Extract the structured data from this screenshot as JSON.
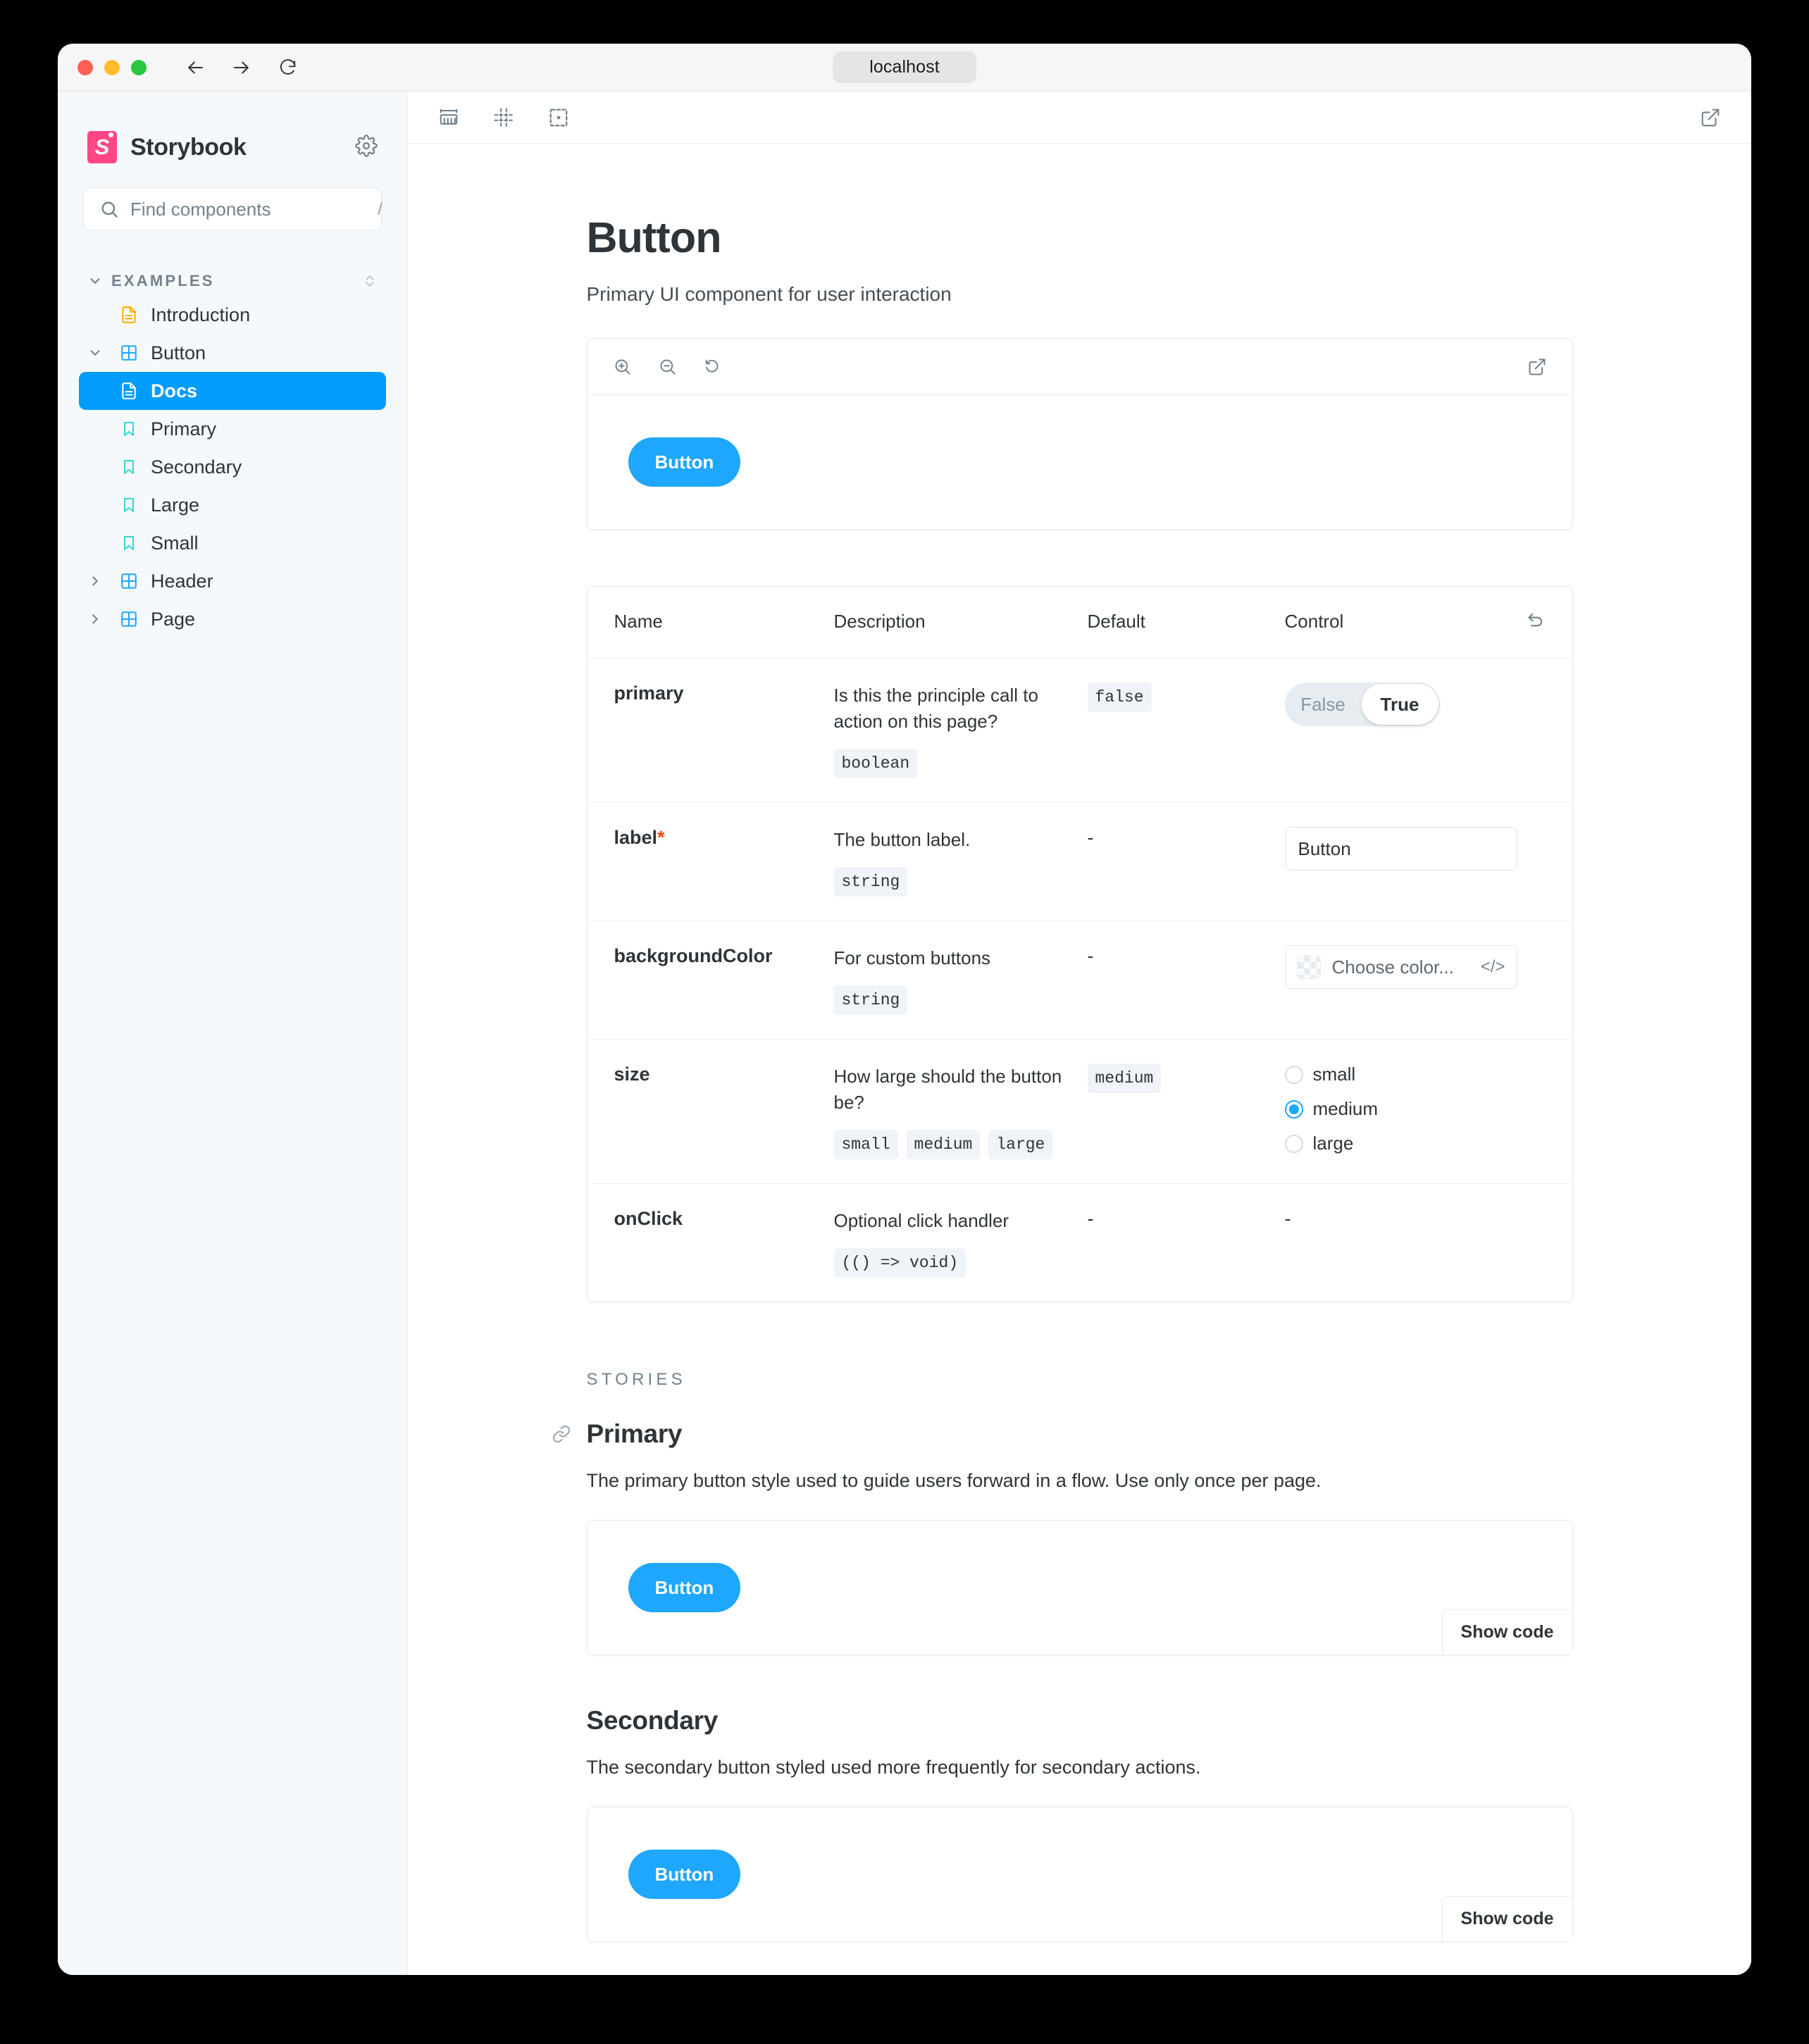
{
  "browser": {
    "url": "localhost",
    "back_icon": "arrow-left-icon",
    "forward_icon": "arrow-right-icon",
    "reload_icon": "reload-icon"
  },
  "sidebar": {
    "brand": "Storybook",
    "logo_letter": "S",
    "settings_icon": "gear-icon",
    "search": {
      "placeholder": "Find components",
      "value": "",
      "shortcut": "/",
      "icon": "search-icon"
    },
    "group": {
      "label": "EXAMPLES",
      "expand_icon": "chevron-down-icon",
      "sort_icon": "expand-collapse-icon"
    },
    "items": [
      {
        "label": "Introduction",
        "icon": "document-icon",
        "depth": 1,
        "selected": false,
        "caret": ""
      },
      {
        "label": "Button",
        "icon": "component-icon",
        "depth": 1,
        "selected": false,
        "caret": "down"
      },
      {
        "label": "Docs",
        "icon": "docs-icon",
        "depth": 2,
        "selected": true,
        "caret": ""
      },
      {
        "label": "Primary",
        "icon": "story-bookmark-icon",
        "depth": 2,
        "selected": false,
        "caret": ""
      },
      {
        "label": "Secondary",
        "icon": "story-bookmark-icon",
        "depth": 2,
        "selected": false,
        "caret": ""
      },
      {
        "label": "Large",
        "icon": "story-bookmark-icon",
        "depth": 2,
        "selected": false,
        "caret": ""
      },
      {
        "label": "Small",
        "icon": "story-bookmark-icon",
        "depth": 2,
        "selected": false,
        "caret": ""
      },
      {
        "label": "Header",
        "icon": "component-icon",
        "depth": 1,
        "selected": false,
        "caret": "right"
      },
      {
        "label": "Page",
        "icon": "component-icon",
        "depth": 1,
        "selected": false,
        "caret": "right"
      }
    ]
  },
  "toolbar": {
    "measure_icon": "ruler-measure-icon",
    "grid_icon": "grid-icon",
    "outline_icon": "outline-icon",
    "open_new_tab_icon": "open-in-new-tab-icon"
  },
  "doc": {
    "title": "Button",
    "subtitle": "Primary UI component for user interaction"
  },
  "preview": {
    "zoom_in_icon": "zoom-in-icon",
    "zoom_out_icon": "zoom-out-icon",
    "zoom_reset_icon": "zoom-reset-icon",
    "open_icon": "open-in-new-tab-icon",
    "button_label": "Button"
  },
  "args_table": {
    "headers": [
      "Name",
      "Description",
      "Default",
      "Control"
    ],
    "reset_icon": "reset-undo-icon",
    "rows": [
      {
        "name": "primary",
        "required": false,
        "description": "Is this the principle call to action on this page?",
        "types": [
          "boolean"
        ],
        "default": "false",
        "default_is_code": true,
        "control": {
          "kind": "boolean",
          "false_label": "False",
          "true_label": "True",
          "value": "True"
        }
      },
      {
        "name": "label",
        "required": true,
        "required_marker": "*",
        "description": "The button label.",
        "types": [
          "string"
        ],
        "default": "-",
        "default_is_code": false,
        "control": {
          "kind": "text",
          "value": "Button"
        }
      },
      {
        "name": "backgroundColor",
        "required": false,
        "description": "For custom buttons",
        "types": [
          "string"
        ],
        "default": "-",
        "default_is_code": false,
        "control": {
          "kind": "color",
          "placeholder": "Choose color...",
          "code_toggle": "</>"
        }
      },
      {
        "name": "size",
        "required": false,
        "description": "How large should the button be?",
        "types": [
          "small",
          "medium",
          "large"
        ],
        "default": "medium",
        "default_is_code": true,
        "control": {
          "kind": "radio",
          "options": [
            "small",
            "medium",
            "large"
          ],
          "value": "medium"
        }
      },
      {
        "name": "onClick",
        "required": false,
        "description": "Optional click handler",
        "types": [
          "(() => void)"
        ],
        "default": "-",
        "default_is_code": false,
        "control": {
          "kind": "none",
          "value": "-"
        }
      }
    ]
  },
  "stories": {
    "section_label": "STORIES",
    "anchor_icon": "link-anchor-icon",
    "items": [
      {
        "title": "Primary",
        "description": "The primary button style used to guide users forward in a flow. Use only once per page.",
        "button_label": "Button",
        "show_code_label": "Show code"
      },
      {
        "title": "Secondary",
        "description": "The secondary button styled used more frequently for secondary actions.",
        "button_label": "Button",
        "show_code_label": "Show code"
      }
    ]
  },
  "colors": {
    "accent_blue": "#029cfd",
    "button_blue": "#1ea7fd",
    "brand_pink": "#ff4785",
    "sidebar_bg": "#f6f9fc",
    "text": "#2e3438",
    "muted": "#73828c",
    "required_marker": "#ff4400"
  }
}
